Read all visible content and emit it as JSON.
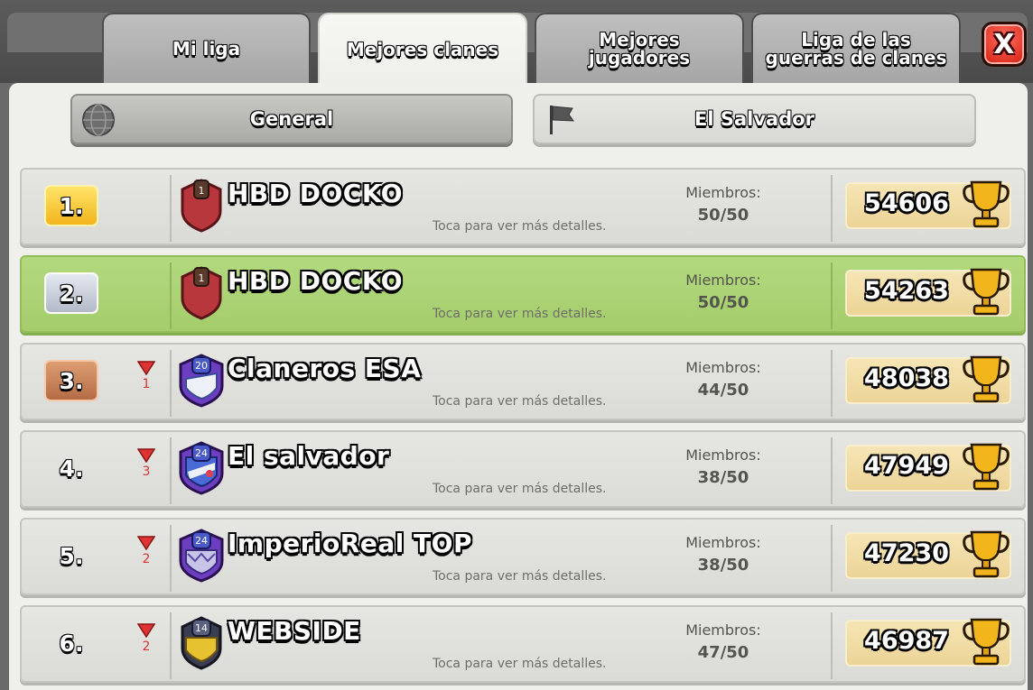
{
  "tabs": [
    {
      "label": "Mi liga",
      "active": false
    },
    {
      "label": "Mejores clanes",
      "active": true
    },
    {
      "label": "Mejores\njugadores",
      "active": false
    },
    {
      "label": "Liga de las\nguerras de clanes",
      "active": false
    }
  ],
  "close_button": {
    "label": "X",
    "color": "#e02a1a"
  },
  "filters": {
    "general": {
      "label": "General",
      "icon": "globe-icon",
      "selected": true
    },
    "country": {
      "label": "El Salvador",
      "icon": "flag-icon",
      "selected": false
    }
  },
  "rows": [
    {
      "rank": "1.",
      "badge": "gold",
      "trend": "",
      "trend_value": "",
      "clan_name": "HBD DOCKO",
      "badge_level": "1",
      "hint": "Toca para ver más detalles.",
      "members_label": "Miembros:",
      "members": "50/50",
      "score": "54606",
      "highlight": false
    },
    {
      "rank": "2.",
      "badge": "silver",
      "trend": "",
      "trend_value": "",
      "clan_name": "HBD DOCKO",
      "badge_level": "1",
      "hint": "Toca para ver más detalles.",
      "members_label": "Miembros:",
      "members": "50/50",
      "score": "54263",
      "highlight": true
    },
    {
      "rank": "3.",
      "badge": "bronze",
      "trend": "down",
      "trend_value": "1",
      "clan_name": "Claneros ESA",
      "badge_level": "20",
      "hint": "Toca para ver más detalles.",
      "members_label": "Miembros:",
      "members": "44/50",
      "score": "48038",
      "highlight": false
    },
    {
      "rank": "4.",
      "badge": "plain",
      "trend": "down",
      "trend_value": "3",
      "clan_name": "El salvador",
      "badge_level": "24",
      "hint": "Toca para ver más detalles.",
      "members_label": "Miembros:",
      "members": "38/50",
      "score": "47949",
      "highlight": false
    },
    {
      "rank": "5.",
      "badge": "plain",
      "trend": "down",
      "trend_value": "2",
      "clan_name": "ImperioReal TOP",
      "badge_level": "24",
      "hint": "Toca para ver más detalles.",
      "members_label": "Miembros:",
      "members": "38/50",
      "score": "47230",
      "highlight": false
    },
    {
      "rank": "6.",
      "badge": "plain",
      "trend": "down",
      "trend_value": "2",
      "clan_name": "WEBSIDE",
      "badge_level": "14",
      "hint": "Toca para ver más detalles.",
      "members_label": "Miembros:",
      "members": "47/50",
      "score": "46987",
      "highlight": false
    }
  ],
  "colors": {
    "highlight_row": "#a9d073",
    "trend_down": "#dd3333",
    "score_box": "#f2dca6"
  }
}
